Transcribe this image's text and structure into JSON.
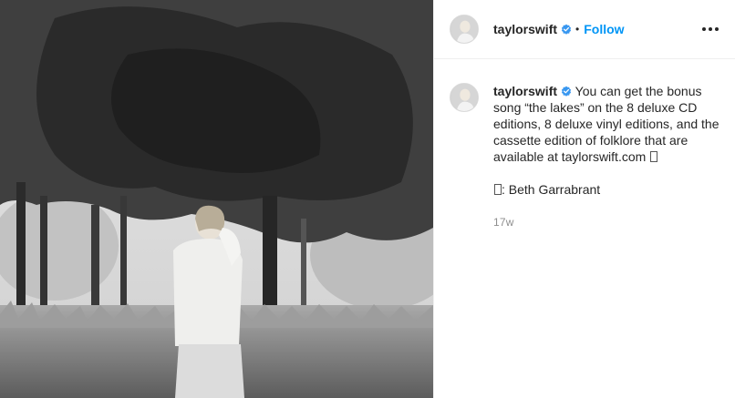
{
  "post": {
    "username": "taylorswift",
    "follow_label": "Follow",
    "separator": "•",
    "caption_text": "You can get the bonus song “the lakes” on the 8 deluxe CD editions, 8 deluxe vinyl editions, and the cassette edition of folklore that are available at taylorswift.com",
    "credit_name": ": Beth Garrabrant",
    "timestamp": "17w",
    "colors": {
      "accent": "#0095f6",
      "text": "#262626",
      "muted": "#8e8e8e",
      "border": "#efefef"
    },
    "icons": [
      "verified-badge-icon",
      "more-options-icon"
    ]
  }
}
